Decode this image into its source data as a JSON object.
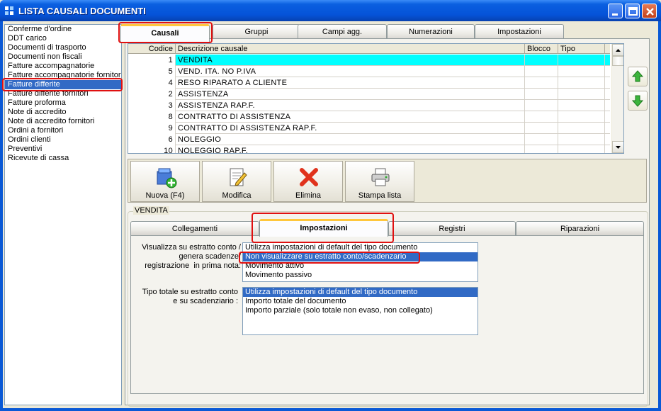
{
  "window": {
    "title": "LISTA CAUSALI DOCUMENTI"
  },
  "left_list": [
    "Conferme d'ordine",
    "DDT carico",
    "Documenti di trasporto",
    "Documenti non fiscali",
    "Fatture accompagnatorie",
    "Fatture accompagnatorie fornitori",
    "Fatture differite",
    "Fatture differite fornitori",
    "Fatture proforma",
    "Note di accredito",
    "Note di accredito fornitori",
    "Ordini a fornitori",
    "Ordini clienti",
    "Preventivi",
    "Ricevute di cassa"
  ],
  "left_selected": "Fatture differite",
  "main_tabs": [
    "Causali",
    "Gruppi",
    "Campi agg.",
    "Numerazioni",
    "Impostazioni"
  ],
  "grid": {
    "headers": [
      "Codice",
      "Descrizione causale",
      "Blocco",
      "Tipo"
    ],
    "rows": [
      [
        "1",
        "VENDITA",
        "",
        ""
      ],
      [
        "5",
        "VEND. ITA. NO P.IVA",
        "",
        ""
      ],
      [
        "4",
        "RESO RIPARATO A CLIENTE",
        "",
        ""
      ],
      [
        "2",
        "ASSISTENZA",
        "",
        ""
      ],
      [
        "3",
        "ASSISTENZA RAP.F.",
        "",
        ""
      ],
      [
        "8",
        "CONTRATTO DI ASSISTENZA",
        "",
        ""
      ],
      [
        "9",
        "CONTRATTO DI ASSISTENZA RAP.F.",
        "",
        ""
      ],
      [
        "6",
        "NOLEGGIO",
        "",
        ""
      ],
      [
        "10",
        "NOLEGGIO RAP.F.",
        "",
        ""
      ]
    ],
    "selected_row": 0
  },
  "toolbar": {
    "new_label": "Nuova (F4)",
    "edit_label": "Modifica",
    "delete_label": "Elimina",
    "print_label": "Stampa lista"
  },
  "group": {
    "title": "VENDITA",
    "tabs": [
      "Collegamenti",
      "Impostazioni",
      "Registri",
      "Riparazioni"
    ],
    "active_tab": "Impostazioni",
    "statement_label": "Visualizza su estratto conto /\ngenera scadenze/\nregistrazione  in prima nota:",
    "statement_options": [
      "Utilizza impostazioni di default del tipo documento",
      "Non visualizzare su estratto conto/scadenzario",
      "Movimento attivo",
      "Movimento passivo"
    ],
    "statement_selected": 1,
    "total_label": "Tipo totale su estratto conto\ne su scadenziario :",
    "total_options": [
      "Utilizza impostazioni di default del tipo documento",
      "Importo totale del documento",
      "Importo parziale (solo totale non evaso, non collegato)"
    ],
    "total_selected": 0
  },
  "colors": {
    "titlebar": "#0553d8",
    "selection": "#316ac5",
    "grid_selected_row": "#00ffff",
    "highlight_box": "#e01010"
  }
}
